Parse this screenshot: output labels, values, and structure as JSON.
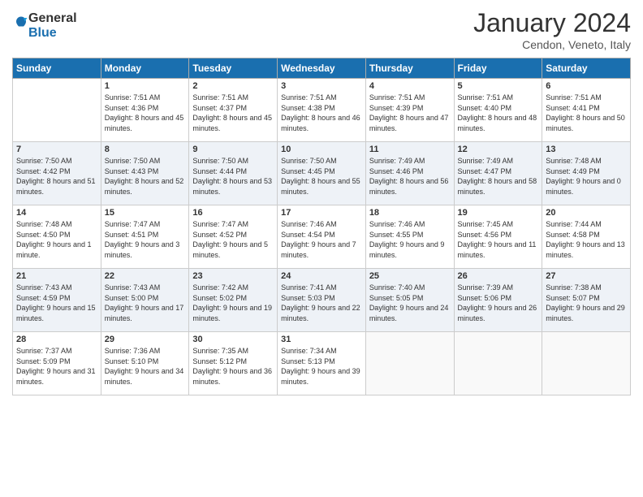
{
  "logo": {
    "general": "General",
    "blue": "Blue"
  },
  "title": "January 2024",
  "location": "Cendon, Veneto, Italy",
  "headers": [
    "Sunday",
    "Monday",
    "Tuesday",
    "Wednesday",
    "Thursday",
    "Friday",
    "Saturday"
  ],
  "weeks": [
    [
      {
        "day": "",
        "sunrise": "",
        "sunset": "",
        "daylight": ""
      },
      {
        "day": "1",
        "sunrise": "Sunrise: 7:51 AM",
        "sunset": "Sunset: 4:36 PM",
        "daylight": "Daylight: 8 hours and 45 minutes."
      },
      {
        "day": "2",
        "sunrise": "Sunrise: 7:51 AM",
        "sunset": "Sunset: 4:37 PM",
        "daylight": "Daylight: 8 hours and 45 minutes."
      },
      {
        "day": "3",
        "sunrise": "Sunrise: 7:51 AM",
        "sunset": "Sunset: 4:38 PM",
        "daylight": "Daylight: 8 hours and 46 minutes."
      },
      {
        "day": "4",
        "sunrise": "Sunrise: 7:51 AM",
        "sunset": "Sunset: 4:39 PM",
        "daylight": "Daylight: 8 hours and 47 minutes."
      },
      {
        "day": "5",
        "sunrise": "Sunrise: 7:51 AM",
        "sunset": "Sunset: 4:40 PM",
        "daylight": "Daylight: 8 hours and 48 minutes."
      },
      {
        "day": "6",
        "sunrise": "Sunrise: 7:51 AM",
        "sunset": "Sunset: 4:41 PM",
        "daylight": "Daylight: 8 hours and 50 minutes."
      }
    ],
    [
      {
        "day": "7",
        "sunrise": "Sunrise: 7:50 AM",
        "sunset": "Sunset: 4:42 PM",
        "daylight": "Daylight: 8 hours and 51 minutes."
      },
      {
        "day": "8",
        "sunrise": "Sunrise: 7:50 AM",
        "sunset": "Sunset: 4:43 PM",
        "daylight": "Daylight: 8 hours and 52 minutes."
      },
      {
        "day": "9",
        "sunrise": "Sunrise: 7:50 AM",
        "sunset": "Sunset: 4:44 PM",
        "daylight": "Daylight: 8 hours and 53 minutes."
      },
      {
        "day": "10",
        "sunrise": "Sunrise: 7:50 AM",
        "sunset": "Sunset: 4:45 PM",
        "daylight": "Daylight: 8 hours and 55 minutes."
      },
      {
        "day": "11",
        "sunrise": "Sunrise: 7:49 AM",
        "sunset": "Sunset: 4:46 PM",
        "daylight": "Daylight: 8 hours and 56 minutes."
      },
      {
        "day": "12",
        "sunrise": "Sunrise: 7:49 AM",
        "sunset": "Sunset: 4:47 PM",
        "daylight": "Daylight: 8 hours and 58 minutes."
      },
      {
        "day": "13",
        "sunrise": "Sunrise: 7:48 AM",
        "sunset": "Sunset: 4:49 PM",
        "daylight": "Daylight: 9 hours and 0 minutes."
      }
    ],
    [
      {
        "day": "14",
        "sunrise": "Sunrise: 7:48 AM",
        "sunset": "Sunset: 4:50 PM",
        "daylight": "Daylight: 9 hours and 1 minute."
      },
      {
        "day": "15",
        "sunrise": "Sunrise: 7:47 AM",
        "sunset": "Sunset: 4:51 PM",
        "daylight": "Daylight: 9 hours and 3 minutes."
      },
      {
        "day": "16",
        "sunrise": "Sunrise: 7:47 AM",
        "sunset": "Sunset: 4:52 PM",
        "daylight": "Daylight: 9 hours and 5 minutes."
      },
      {
        "day": "17",
        "sunrise": "Sunrise: 7:46 AM",
        "sunset": "Sunset: 4:54 PM",
        "daylight": "Daylight: 9 hours and 7 minutes."
      },
      {
        "day": "18",
        "sunrise": "Sunrise: 7:46 AM",
        "sunset": "Sunset: 4:55 PM",
        "daylight": "Daylight: 9 hours and 9 minutes."
      },
      {
        "day": "19",
        "sunrise": "Sunrise: 7:45 AM",
        "sunset": "Sunset: 4:56 PM",
        "daylight": "Daylight: 9 hours and 11 minutes."
      },
      {
        "day": "20",
        "sunrise": "Sunrise: 7:44 AM",
        "sunset": "Sunset: 4:58 PM",
        "daylight": "Daylight: 9 hours and 13 minutes."
      }
    ],
    [
      {
        "day": "21",
        "sunrise": "Sunrise: 7:43 AM",
        "sunset": "Sunset: 4:59 PM",
        "daylight": "Daylight: 9 hours and 15 minutes."
      },
      {
        "day": "22",
        "sunrise": "Sunrise: 7:43 AM",
        "sunset": "Sunset: 5:00 PM",
        "daylight": "Daylight: 9 hours and 17 minutes."
      },
      {
        "day": "23",
        "sunrise": "Sunrise: 7:42 AM",
        "sunset": "Sunset: 5:02 PM",
        "daylight": "Daylight: 9 hours and 19 minutes."
      },
      {
        "day": "24",
        "sunrise": "Sunrise: 7:41 AM",
        "sunset": "Sunset: 5:03 PM",
        "daylight": "Daylight: 9 hours and 22 minutes."
      },
      {
        "day": "25",
        "sunrise": "Sunrise: 7:40 AM",
        "sunset": "Sunset: 5:05 PM",
        "daylight": "Daylight: 9 hours and 24 minutes."
      },
      {
        "day": "26",
        "sunrise": "Sunrise: 7:39 AM",
        "sunset": "Sunset: 5:06 PM",
        "daylight": "Daylight: 9 hours and 26 minutes."
      },
      {
        "day": "27",
        "sunrise": "Sunrise: 7:38 AM",
        "sunset": "Sunset: 5:07 PM",
        "daylight": "Daylight: 9 hours and 29 minutes."
      }
    ],
    [
      {
        "day": "28",
        "sunrise": "Sunrise: 7:37 AM",
        "sunset": "Sunset: 5:09 PM",
        "daylight": "Daylight: 9 hours and 31 minutes."
      },
      {
        "day": "29",
        "sunrise": "Sunrise: 7:36 AM",
        "sunset": "Sunset: 5:10 PM",
        "daylight": "Daylight: 9 hours and 34 minutes."
      },
      {
        "day": "30",
        "sunrise": "Sunrise: 7:35 AM",
        "sunset": "Sunset: 5:12 PM",
        "daylight": "Daylight: 9 hours and 36 minutes."
      },
      {
        "day": "31",
        "sunrise": "Sunrise: 7:34 AM",
        "sunset": "Sunset: 5:13 PM",
        "daylight": "Daylight: 9 hours and 39 minutes."
      },
      {
        "day": "",
        "sunrise": "",
        "sunset": "",
        "daylight": ""
      },
      {
        "day": "",
        "sunrise": "",
        "sunset": "",
        "daylight": ""
      },
      {
        "day": "",
        "sunrise": "",
        "sunset": "",
        "daylight": ""
      }
    ]
  ]
}
